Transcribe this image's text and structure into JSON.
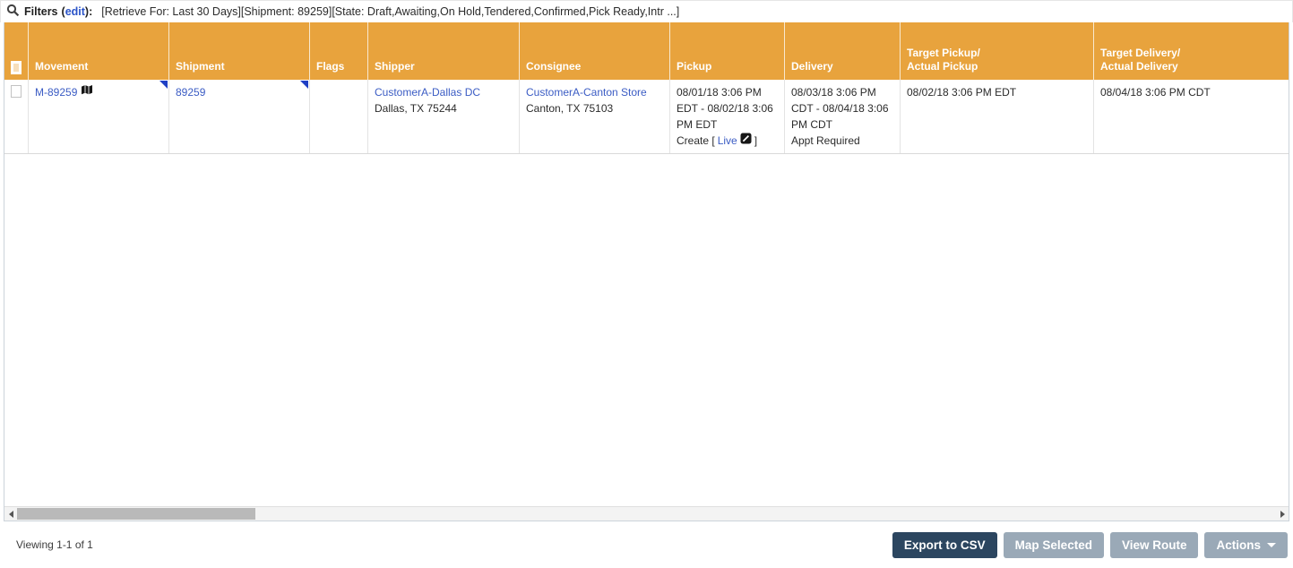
{
  "filters": {
    "label": "Filters",
    "paren_open": "(",
    "edit_label": "edit",
    "paren_close": "):",
    "summary": "[Retrieve For: Last 30 Days][Shipment: 89259][State: Draft,Awaiting,On Hold,Tendered,Confirmed,Pick Ready,Intr ...]"
  },
  "table": {
    "columns": {
      "movement": "Movement",
      "shipment": "Shipment",
      "flags": "Flags",
      "shipper": "Shipper",
      "consignee": "Consignee",
      "pickup": "Pickup",
      "delivery": "Delivery",
      "target_pickup": {
        "line1": "Target Pickup/",
        "line2": "Actual Pickup"
      },
      "target_delivery": {
        "line1": "Target Delivery/",
        "line2": "Actual Delivery"
      }
    },
    "row": {
      "movement": "M-89259",
      "shipment": "89259",
      "shipper_name": "CustomerA-Dallas DC",
      "shipper_address": "Dallas, TX 75244",
      "consignee_name": "CustomerA-Canton Store",
      "consignee_address": "Canton, TX 75103",
      "pickup_window": "08/01/18 3:06 PM EDT - 08/02/18 3:06 PM EDT",
      "pickup_create_prefix": "Create [",
      "pickup_live_label": "Live",
      "pickup_create_suffix": "]",
      "delivery_window": "08/03/18 3:06 PM CDT - 08/04/18 3:06 PM CDT",
      "delivery_note": "Appt Required",
      "target_pickup": "08/02/18 3:06 PM EDT",
      "target_delivery": "08/04/18 3:06 PM CDT"
    }
  },
  "footer": {
    "viewing": "Viewing 1-1 of 1",
    "export_label": "Export to CSV",
    "map_selected_label": "Map Selected",
    "view_route_label": "View Route",
    "actions_label": "Actions"
  },
  "icons": {
    "search": "search-icon",
    "movement_map": "map-icon",
    "note_marker": "note-corner-icon",
    "live_edit": "edit-square-icon",
    "scroll_left": "arrow-left-icon",
    "scroll_right": "arrow-right-icon",
    "actions_caret": "caret-down-icon"
  },
  "colors": {
    "header_orange": "#E8A33D",
    "link_blue": "#3B5CC4",
    "note_blue": "#1E3FC4",
    "export_button": "#2C4660",
    "gray_button": "#9AA9B7",
    "scroll_thumb": "#B9B9B9"
  }
}
